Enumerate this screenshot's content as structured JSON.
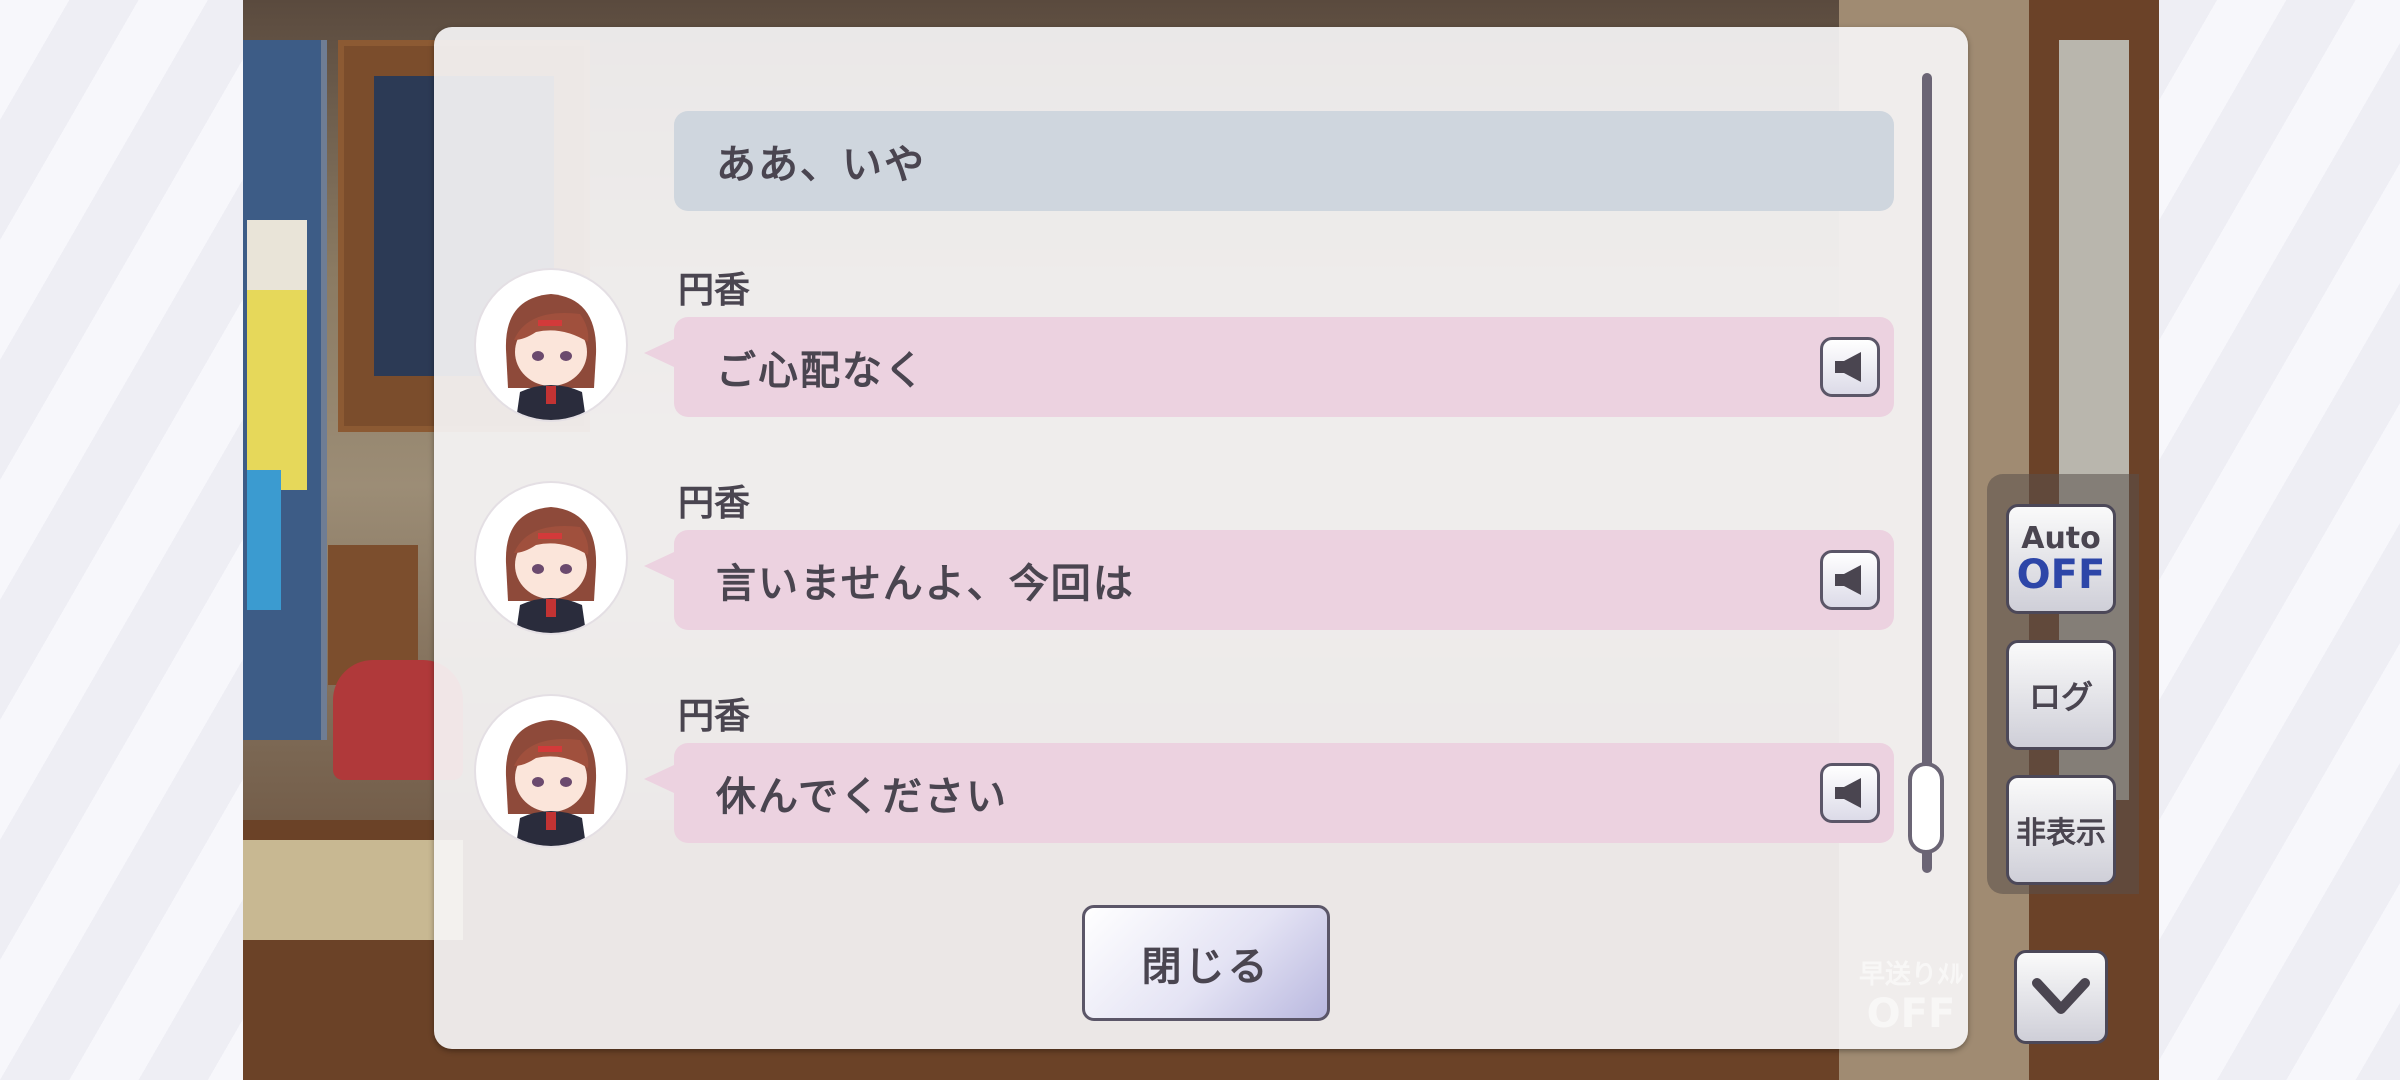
{
  "log": {
    "entries": [
      {
        "type": "player",
        "text": "ああ、いや"
      },
      {
        "type": "idol",
        "speaker": "円香",
        "text": "ご心配なく",
        "voice_icon": "speaker-icon"
      },
      {
        "type": "idol",
        "speaker": "円香",
        "text": "言いませんよ、今回は",
        "voice_icon": "speaker-icon"
      },
      {
        "type": "idol",
        "speaker": "円香",
        "text": "休んでください",
        "voice_icon": "speaker-icon"
      }
    ],
    "close_label": "閉じる"
  },
  "controls": {
    "auto_label": "Auto",
    "auto_state": "OFF",
    "log_label": "ログ",
    "hide_label": "非表示",
    "fast_forward_label": "早送りﾒﾙ",
    "fast_forward_state": "OFF",
    "down_icon": "chevron-down-icon"
  },
  "colors": {
    "player_bubble": "#cfd6de",
    "idol_bubble": "#ecd2e0",
    "auto_off": "#2d46a8"
  }
}
